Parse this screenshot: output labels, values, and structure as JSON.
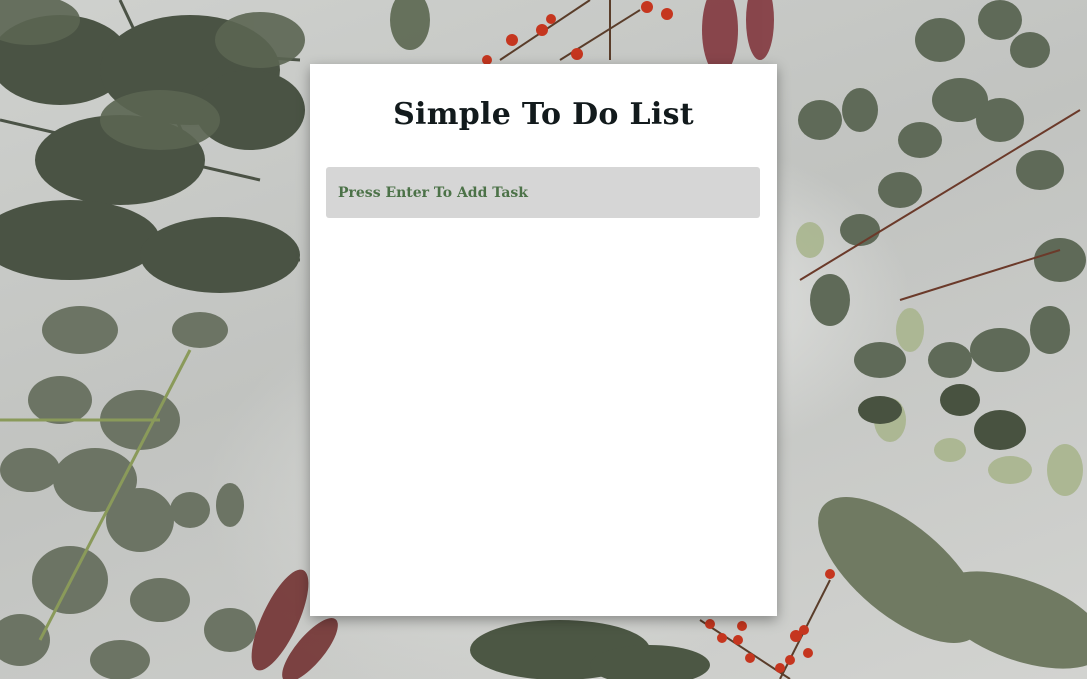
{
  "app": {
    "title": "Simple To Do List"
  },
  "task_input": {
    "placeholder": "Press Enter To Add Task",
    "value": ""
  },
  "tasks": [],
  "colors": {
    "card_background": "#ffffff",
    "input_background": "#d6d6d6",
    "placeholder_text": "#4c7248",
    "title_text": "#121a1c"
  }
}
